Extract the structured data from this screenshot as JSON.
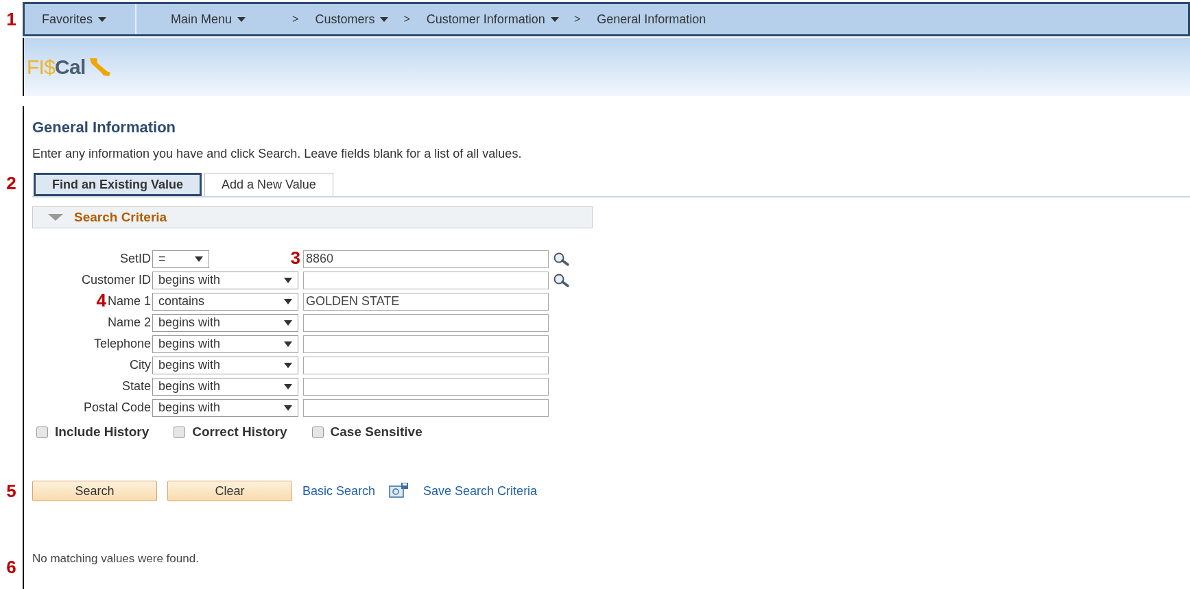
{
  "nav": {
    "callout": "1",
    "items": [
      {
        "label": "Favorites",
        "kind": "menu"
      },
      {
        "kind": "divider"
      },
      {
        "label": "Main Menu",
        "kind": "menu"
      },
      {
        "label": ">",
        "kind": "separator"
      },
      {
        "label": "Customers",
        "kind": "menu"
      },
      {
        "label": ">",
        "kind": "separator"
      },
      {
        "label": "Customer Information",
        "kind": "menu"
      },
      {
        "label": ">",
        "kind": "separator"
      },
      {
        "label": "General Information",
        "kind": "current"
      }
    ]
  },
  "logo": {
    "part1": "FI$",
    "part2": "Cal"
  },
  "page": {
    "title": "General Information",
    "instructions": "Enter any information you have and click Search. Leave fields blank for a list of all values."
  },
  "tabs": {
    "callout": "2",
    "items": [
      {
        "label": "Find an Existing Value",
        "selected": true
      },
      {
        "label": "Add a New Value",
        "selected": false
      }
    ]
  },
  "section": {
    "title": "Search Criteria",
    "expanded": true
  },
  "fields": [
    {
      "label": "SetID",
      "operator": "=",
      "value": "8860",
      "lookup": true,
      "input_callout": "3",
      "short_operator": true
    },
    {
      "label": "Customer ID",
      "operator": "begins with",
      "lookup": true,
      "short_operator": false
    },
    {
      "label": "Name 1",
      "operator": "contains",
      "value": "GOLDEN STATE",
      "label_callout": "4"
    },
    {
      "label": "Name 2",
      "operator": "begins with"
    },
    {
      "label": "Telephone",
      "operator": "begins with"
    },
    {
      "label": "City",
      "operator": "begins with"
    },
    {
      "label": "State",
      "operator": "begins with"
    },
    {
      "label": "Postal Code",
      "operator": "begins with"
    }
  ],
  "options": [
    {
      "label": "Include History",
      "checked": false
    },
    {
      "label": "Correct History",
      "checked": false
    },
    {
      "label": "Case Sensitive",
      "checked": false
    }
  ],
  "actions": {
    "callout": "5",
    "buttons": [
      "Search",
      "Clear"
    ],
    "links": [
      "Basic Search",
      "Save Search Criteria"
    ]
  },
  "message": {
    "callout": "6",
    "text": "No matching values were found."
  }
}
